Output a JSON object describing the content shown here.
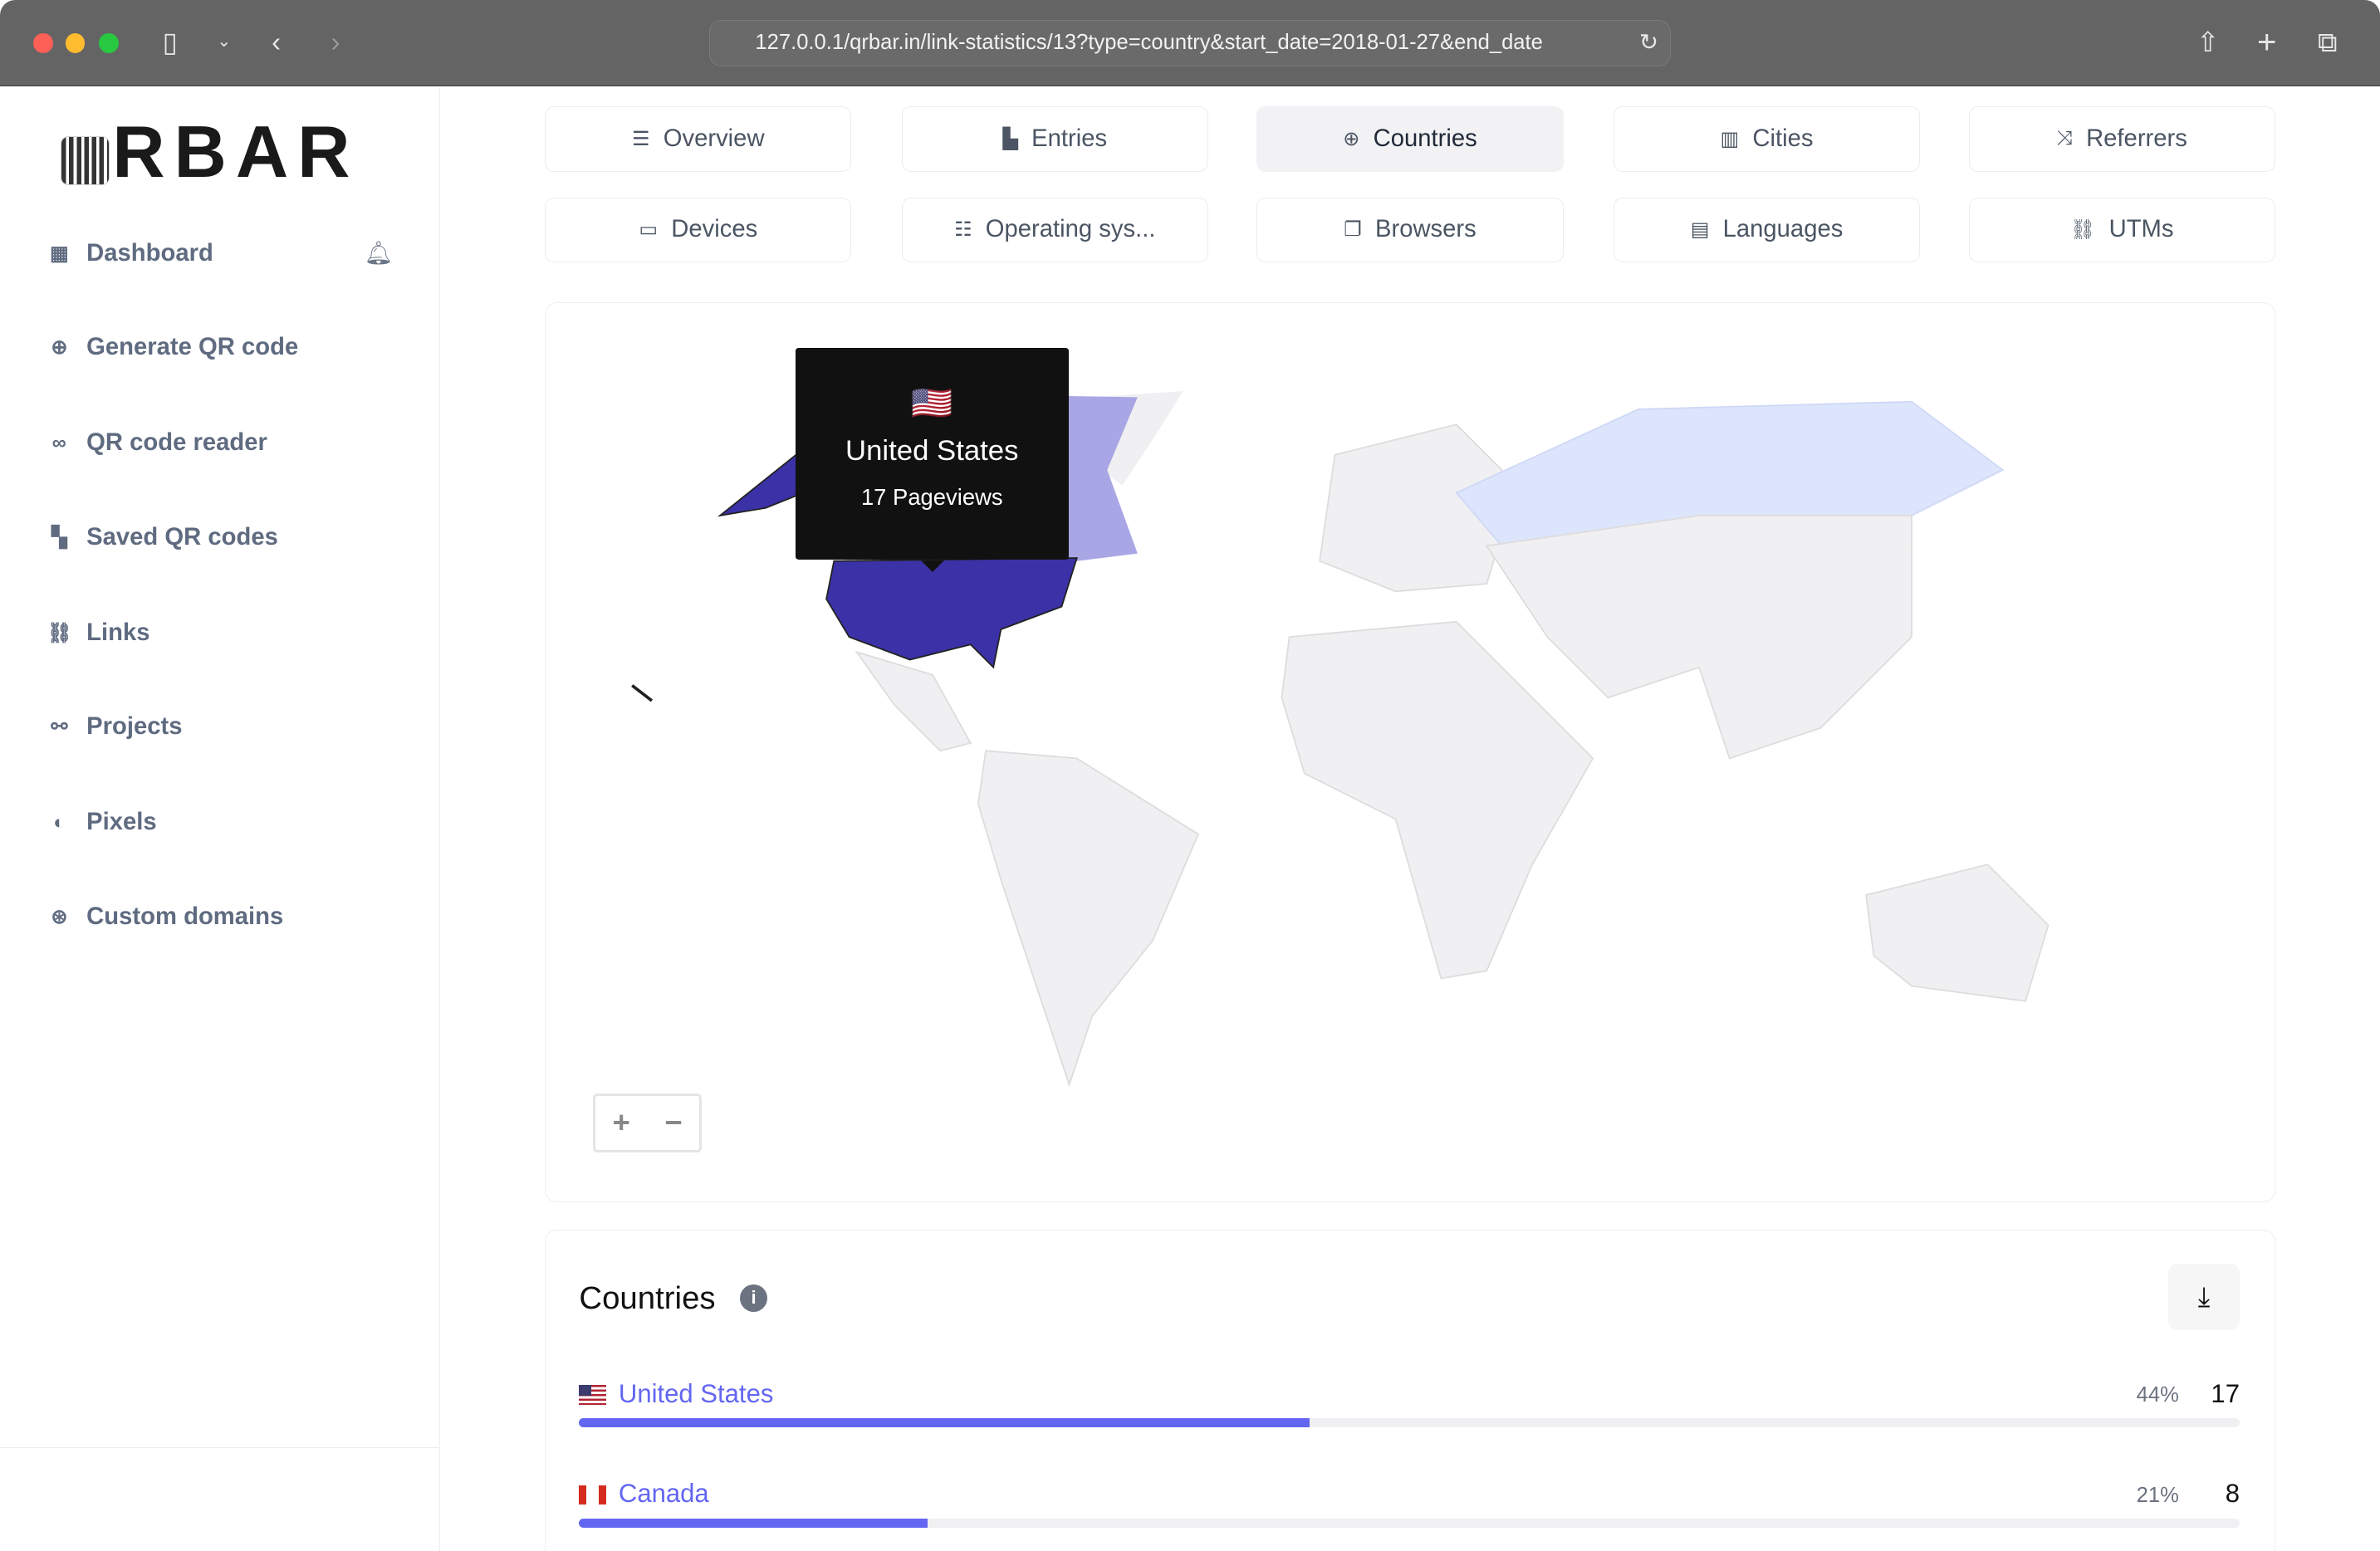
{
  "browser": {
    "url": "127.0.0.1/qrbar.in/link-statistics/13?type=country&start_date=2018-01-27&end_date"
  },
  "sidebar": {
    "logo": "QRBAR",
    "logo_visible": "RBAR",
    "items": [
      {
        "label": "Dashboard",
        "icon": "table-icon"
      },
      {
        "label": "Generate QR code",
        "icon": "plus-circle-icon"
      },
      {
        "label": "QR code reader",
        "icon": "glasses-icon"
      },
      {
        "label": "Saved QR codes",
        "icon": "qr-icon"
      },
      {
        "label": "Links",
        "icon": "link-icon"
      },
      {
        "label": "Projects",
        "icon": "projects-icon"
      },
      {
        "label": "Pixels",
        "icon": "half-circle-icon"
      },
      {
        "label": "Custom domains",
        "icon": "globe-icon"
      }
    ]
  },
  "tabs": [
    {
      "label": "Overview",
      "icon": "list-icon"
    },
    {
      "label": "Entries",
      "icon": "chart-icon"
    },
    {
      "label": "Countries",
      "icon": "globe-icon",
      "active": true
    },
    {
      "label": "Cities",
      "icon": "city-icon"
    },
    {
      "label": "Referrers",
      "icon": "shuffle-icon"
    },
    {
      "label": "Devices",
      "icon": "laptop-icon"
    },
    {
      "label": "Operating sys...",
      "icon": "server-icon"
    },
    {
      "label": "Browsers",
      "icon": "window-icon"
    },
    {
      "label": "Languages",
      "icon": "language-icon"
    },
    {
      "label": "UTMs",
      "icon": "link-icon"
    }
  ],
  "map": {
    "tooltip": {
      "flag": "🇺🇸",
      "country": "United States",
      "value": "17 Pageviews"
    },
    "zoom_in": "+",
    "zoom_out": "−",
    "colors": {
      "high": "#3b32a8",
      "mid": "#a9a6e6",
      "low": "#dde5fc",
      "none": "#f0f0f2"
    }
  },
  "countries": {
    "title": "Countries",
    "rows": [
      {
        "name": "United States",
        "percent": "44%",
        "count": "17",
        "fraction": 0.44
      },
      {
        "name": "Canada",
        "percent": "21%",
        "count": "8",
        "fraction": 0.21
      }
    ]
  },
  "accent": "#6366f1"
}
